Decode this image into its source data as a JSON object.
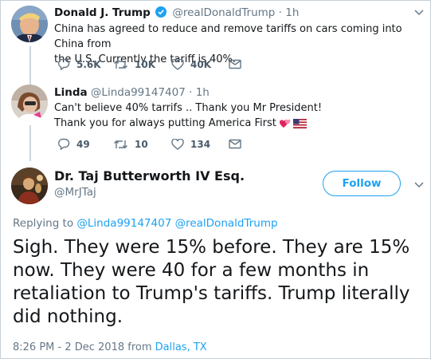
{
  "tweets": [
    {
      "name": "Donald J. Trump",
      "handle": "@realDonaldTrump",
      "dot": "·",
      "time": "1h",
      "verified": true,
      "text_lines": [
        "China has agreed to reduce and remove tariffs on cars coming into China from",
        "the U.S. Currently the tariff is 40%."
      ],
      "replies": "5.6K",
      "retweets": "10K",
      "likes": "40K"
    },
    {
      "name": "Linda",
      "handle": "@Linda99147407",
      "dot": "·",
      "time": "1h",
      "text_lines": [
        "Can't believe 40% tarrifs .. Thank you Mr President!",
        "Thank you for always putting America First"
      ],
      "replies": "49",
      "retweets": "10",
      "likes": "134"
    }
  ],
  "main_tweet": {
    "name": "Dr. Taj Butterworth IV Esq.",
    "handle": "@MrJTaj",
    "follow_label": "Follow",
    "replying_prefix": "Replying to",
    "replying_to": "@Linda99147407 @realDonaldTrump",
    "text_lines": [
      "Sigh. They were 15% before. They are 15%",
      "now. They were 40 for a few months in",
      "retaliation to Trump's tariffs. Trump literally",
      "did nothing."
    ],
    "timestamp": "8:26 PM - 2 Dec 2018 from",
    "location": "Dallas, TX"
  },
  "colors": {
    "accent": "#1da1f2",
    "muted": "#657786",
    "text": "#14171a",
    "heart_emoji": "#e0245e"
  },
  "icons": [
    "reply-icon",
    "retweet-icon",
    "like-icon",
    "message-icon",
    "verified-icon",
    "caret-down-icon",
    "heart-emoji-icon",
    "us-flag-emoji-icon"
  ]
}
